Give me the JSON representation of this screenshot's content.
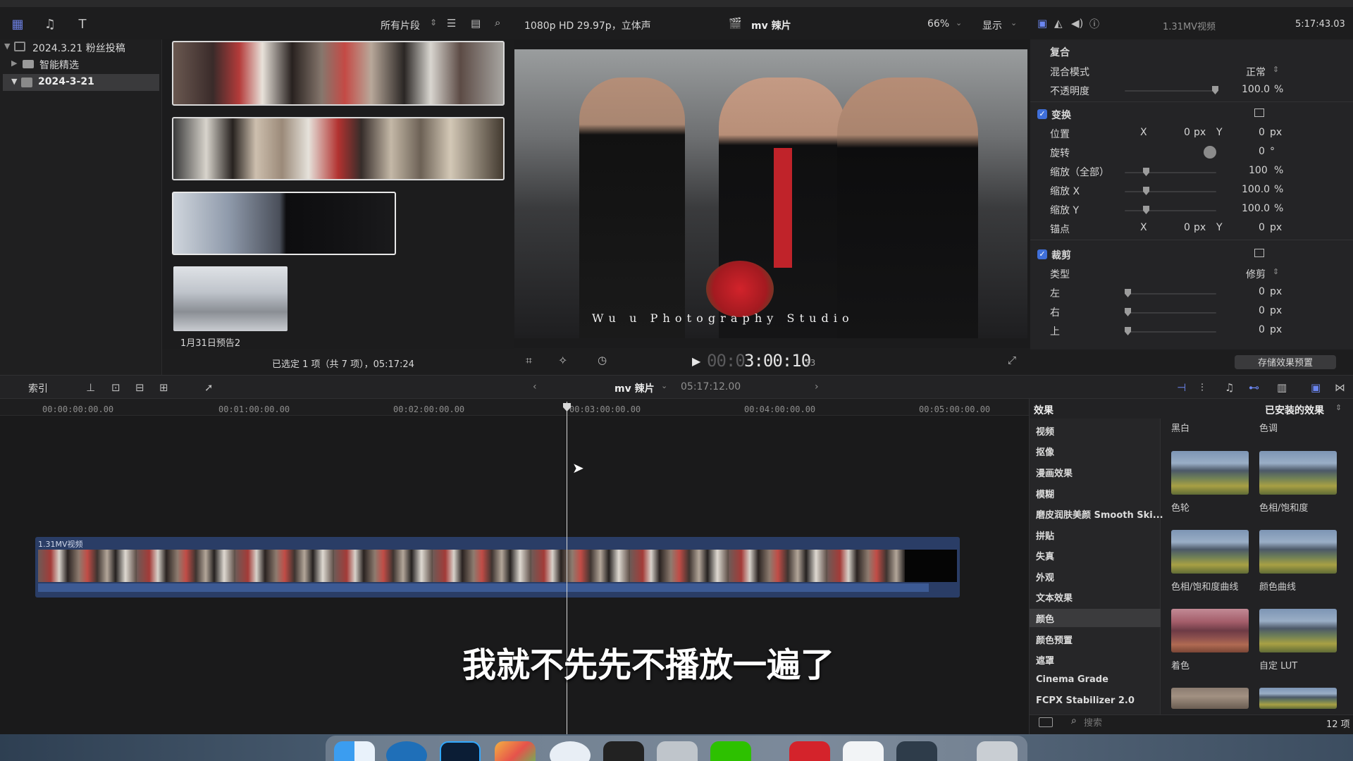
{
  "window": {
    "title_bar_dots": [
      "red",
      "yellow",
      "green"
    ]
  },
  "library": {
    "items": [
      {
        "label": "2024.3.21 粉丝投稿",
        "icon": "library-icon"
      },
      {
        "label": "智能精选",
        "icon": "folder-icon"
      },
      {
        "label": "2024-3-21",
        "icon": "event-icon"
      }
    ]
  },
  "browser": {
    "filter_label": "所有片段",
    "clip4_label": "1月31日预告2",
    "status": "已选定 1 项（共 7 项），05:17:24"
  },
  "viewer": {
    "format": "1080p HD 29.97p，立体声",
    "project": "mv 辣片",
    "zoom": "66%",
    "display_label": "显示",
    "watermark": "W u   u   P h o t o g r a p h y   S t u d i o",
    "timecode_dim": "00:0",
    "timecode": "3:00:10",
    "timecode_frames": "33"
  },
  "inspector": {
    "clip_name": "1.31MV视频",
    "duration": "5:17:43.03",
    "compositing": "复合",
    "blend_mode_label": "混合模式",
    "blend_mode_value": "正常",
    "opacity_label": "不透明度",
    "opacity_value": "100.0",
    "opacity_unit": "%",
    "transform": "变换",
    "position_label": "位置",
    "x": "X",
    "y": "Y",
    "pos_x": "0",
    "pos_y": "0",
    "px": "px",
    "rotation_label": "旋转",
    "rotation_value": "0",
    "deg": "°",
    "scale_all_label": "缩放（全部）",
    "scale_all_value": "100",
    "scale_x_label": "缩放 X",
    "scale_x_value": "100.0",
    "scale_y_label": "缩放 Y",
    "scale_y_value": "100.0",
    "anchor_label": "锚点",
    "anchor_x": "0",
    "anchor_y": "0",
    "crop": "裁剪",
    "type_label": "类型",
    "type_value": "修剪",
    "left_label": "左",
    "right_label": "右",
    "top_label": "上",
    "crop_left": "0",
    "crop_right": "0",
    "crop_top": "0",
    "save_preset": "存储效果预置"
  },
  "timeline": {
    "index_label": "索引",
    "project": "mv 辣片",
    "duration": "05:17:12.00",
    "ruler": [
      "00:00:00:00.00",
      "00:01:00:00.00",
      "00:02:00:00.00",
      "00:03:00:00.00",
      "00:04:00:00.00",
      "00:05:00:00.00"
    ],
    "clip_name": "1.31MV视频",
    "subtitle": "我就不先先不播放一遍了"
  },
  "effects": {
    "title": "效果",
    "installed_label": "已安装的效果",
    "categories": [
      "视频",
      "抠像",
      "漫画效果",
      "模糊",
      "磨皮润肤美颜 Smooth Ski...",
      "拼贴",
      "失真",
      "外观",
      "文本效果",
      "颜色",
      "颜色预置",
      "遮罩",
      "Cinema Grade",
      "FCPX Stabilizer 2.0"
    ],
    "selected_category": "颜色",
    "header_labels": [
      "黑白",
      "色调"
    ],
    "items": [
      "色轮",
      "色相/饱和度",
      "色相/饱和度曲线",
      "颜色曲线",
      "着色",
      "自定 LUT"
    ],
    "search_placeholder": "搜索",
    "count": "12 项"
  }
}
